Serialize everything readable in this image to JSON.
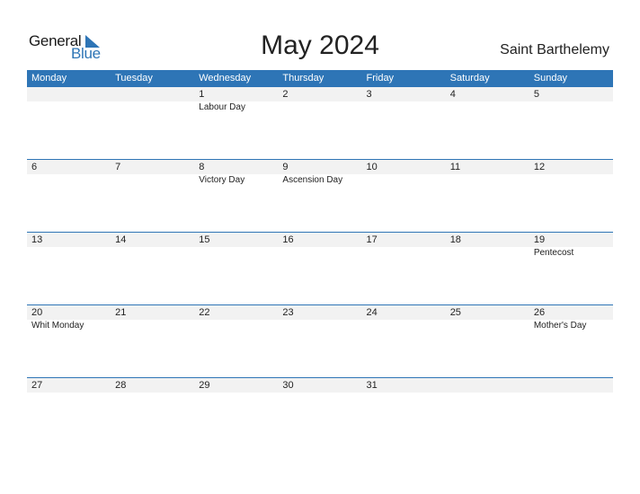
{
  "logo": {
    "line1": "General",
    "line2": "Blue"
  },
  "title": "May 2024",
  "country": "Saint Barthelemy",
  "colors": {
    "accent": "#2e75b6",
    "date_strip": "#f2f2f2"
  },
  "weekdays": [
    "Monday",
    "Tuesday",
    "Wednesday",
    "Thursday",
    "Friday",
    "Saturday",
    "Sunday"
  ],
  "weeks": [
    [
      {
        "day": "",
        "event": ""
      },
      {
        "day": "",
        "event": ""
      },
      {
        "day": "1",
        "event": "Labour Day"
      },
      {
        "day": "2",
        "event": ""
      },
      {
        "day": "3",
        "event": ""
      },
      {
        "day": "4",
        "event": ""
      },
      {
        "day": "5",
        "event": ""
      }
    ],
    [
      {
        "day": "6",
        "event": ""
      },
      {
        "day": "7",
        "event": ""
      },
      {
        "day": "8",
        "event": "Victory Day"
      },
      {
        "day": "9",
        "event": "Ascension Day"
      },
      {
        "day": "10",
        "event": ""
      },
      {
        "day": "11",
        "event": ""
      },
      {
        "day": "12",
        "event": ""
      }
    ],
    [
      {
        "day": "13",
        "event": ""
      },
      {
        "day": "14",
        "event": ""
      },
      {
        "day": "15",
        "event": ""
      },
      {
        "day": "16",
        "event": ""
      },
      {
        "day": "17",
        "event": ""
      },
      {
        "day": "18",
        "event": ""
      },
      {
        "day": "19",
        "event": "Pentecost"
      }
    ],
    [
      {
        "day": "20",
        "event": "Whit Monday"
      },
      {
        "day": "21",
        "event": ""
      },
      {
        "day": "22",
        "event": ""
      },
      {
        "day": "23",
        "event": ""
      },
      {
        "day": "24",
        "event": ""
      },
      {
        "day": "25",
        "event": ""
      },
      {
        "day": "26",
        "event": "Mother's Day"
      }
    ],
    [
      {
        "day": "27",
        "event": ""
      },
      {
        "day": "28",
        "event": ""
      },
      {
        "day": "29",
        "event": ""
      },
      {
        "day": "30",
        "event": ""
      },
      {
        "day": "31",
        "event": ""
      },
      {
        "day": "",
        "event": ""
      },
      {
        "day": "",
        "event": ""
      }
    ]
  ]
}
